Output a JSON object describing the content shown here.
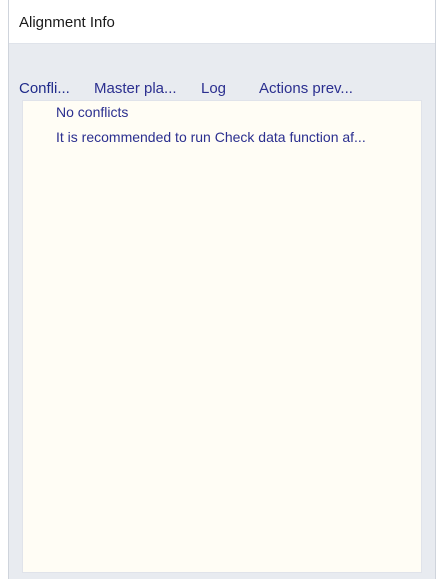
{
  "window": {
    "title": "Alignment Info"
  },
  "tabs": [
    {
      "label": "Confli..."
    },
    {
      "label": "Master pla..."
    },
    {
      "label": "Log"
    },
    {
      "label": "Actions prev..."
    }
  ],
  "panel": {
    "messages": [
      "No conflicts",
      "It is recommended to run Check data function af..."
    ]
  }
}
